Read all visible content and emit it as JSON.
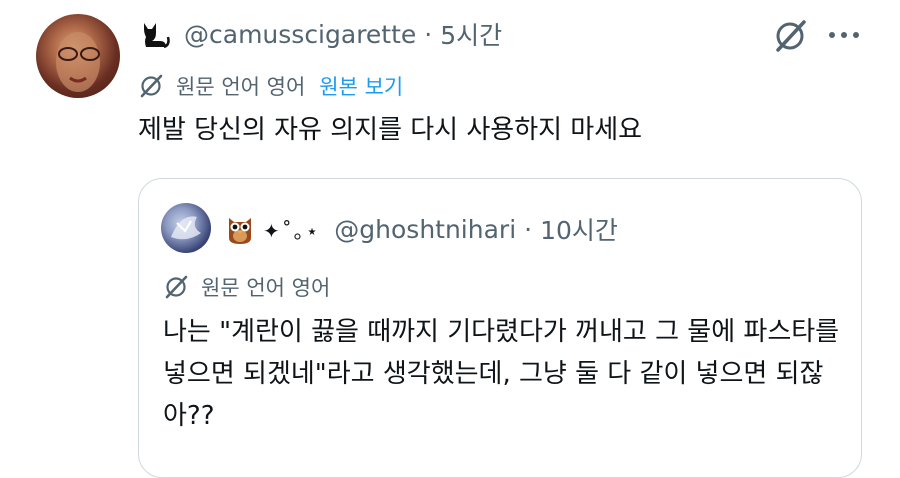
{
  "tweet": {
    "handle": "@camusscigarette",
    "separator": "·",
    "time": "5시간",
    "translation": {
      "label": "원문 언어 영어",
      "view_original": "원본 보기"
    },
    "text": "제발 당신의 자유 의지를 다시 사용하지 마세요"
  },
  "quote": {
    "display_name": "✦˚｡⋆",
    "handle": "@ghoshtnihari",
    "separator": "·",
    "time": "10시간",
    "translation": {
      "label": "원문 언어 영어"
    },
    "text": "나는 \"계란이 끓을 때까지 기다렸다가 꺼내고 그 물에 파스타를 넣으면 되겠네\"라고 생각했는데, 그냥 둘 다 같이 넣으면 되잖아??"
  },
  "icons": {
    "cat": "cat-icon",
    "grok": "slash-circle-icon",
    "more": "more-icon",
    "owl": "owl-icon"
  },
  "colors": {
    "text": "#0f1419",
    "secondary": "#536471",
    "link": "#1d9bf0",
    "border": "#cfd9de"
  }
}
